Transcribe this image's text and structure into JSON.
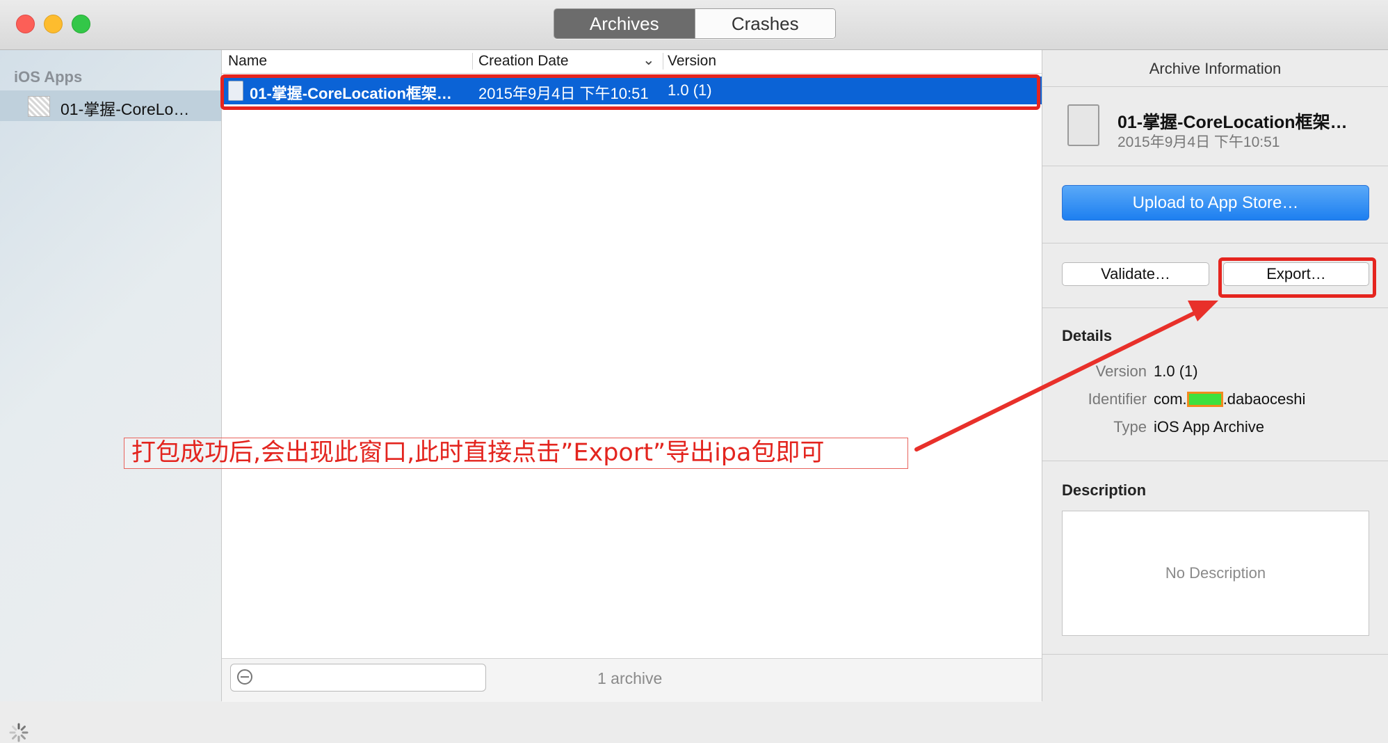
{
  "tabs": [
    {
      "label": "Archives",
      "active": true
    },
    {
      "label": "Crashes",
      "active": false
    }
  ],
  "sidebar": {
    "group_label": "iOS Apps",
    "items": [
      {
        "label": "01-掌握-CoreLo…",
        "selected": true
      }
    ]
  },
  "list": {
    "columns": [
      "Name",
      "Creation Date",
      "Version"
    ],
    "rows": [
      {
        "name": "01-掌握-CoreLocation框架…",
        "date": "2015年9月4日 下午10:51",
        "version": "1.0 (1)",
        "selected": true
      }
    ],
    "search_placeholder": "",
    "count_label": "1 archive"
  },
  "inspector": {
    "title": "Archive Information",
    "app_name": "01-掌握-CoreLocation框架…",
    "app_date": "2015年9月4日 下午10:51",
    "upload_label": "Upload to App Store…",
    "validate_label": "Validate…",
    "export_label": "Export…",
    "details_title": "Details",
    "details": {
      "version_key": "Version",
      "version_val": "1.0 (1)",
      "identifier_key": "Identifier",
      "identifier_prefix": "com.",
      "identifier_suffix": ".dabaoceshi",
      "type_key": "Type",
      "type_val": "iOS App Archive"
    },
    "description_title": "Description",
    "description_placeholder": "No Description"
  },
  "annotation": {
    "text": "打包成功后,会出现此窗口,此时直接点击”Export”导出ipa包即可",
    "color": "#e3241e"
  }
}
